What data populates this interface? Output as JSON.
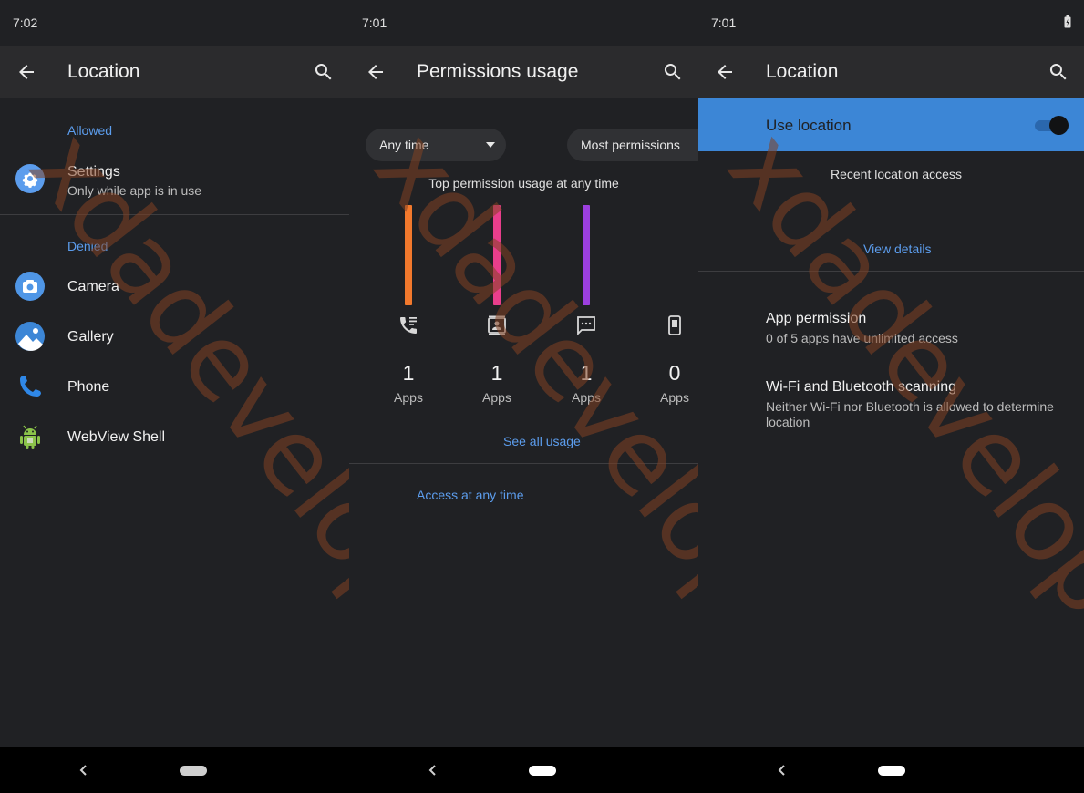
{
  "watermark": "xdadevelopers",
  "screens": [
    {
      "time": "7:02",
      "title": "Location",
      "allowed_label": "Allowed",
      "allowed": [
        {
          "name": "Settings",
          "detail": "Only while app is in use",
          "icon": "settings-gear-icon",
          "color": "#5c9ded"
        }
      ],
      "denied_label": "Denied",
      "denied": [
        {
          "name": "Camera",
          "icon": "camera-icon",
          "color": "#4f96e6"
        },
        {
          "name": "Gallery",
          "icon": "gallery-icon",
          "color": "#3c86d6"
        },
        {
          "name": "Phone",
          "icon": "phone-icon",
          "color": "#2f88e8"
        },
        {
          "name": "WebView Shell",
          "icon": "android-icon",
          "color": "#8bc34a"
        }
      ]
    },
    {
      "time": "7:01",
      "title": "Permissions usage",
      "filter_time": "Any time",
      "filter_sort": "Most permissions",
      "chart_title": "Top permission usage at any time",
      "chart_data": {
        "type": "bar",
        "categories": [
          "call-log-icon",
          "contacts-icon",
          "sms-icon",
          "phone-device-icon"
        ],
        "values": [
          1,
          1,
          1,
          0
        ],
        "colors": [
          "#f2792d",
          "#e83e8c",
          "#9c3fdf",
          "#5c9ded"
        ],
        "unit_label": "Apps"
      },
      "see_all": "See all usage",
      "access_any_time": "Access at any time"
    },
    {
      "time": "7:01",
      "title": "Location",
      "use_location": "Use location",
      "use_location_on": true,
      "recent_access": "Recent location access",
      "view_details": "View details",
      "items": [
        {
          "title": "App permission",
          "detail": "0 of 5 apps have unlimited access"
        },
        {
          "title": "Wi-Fi and Bluetooth scanning",
          "detail": "Neither Wi-Fi nor Bluetooth is allowed to determine location"
        }
      ]
    }
  ],
  "colors": {
    "background": "#202124",
    "appbar": "#2b2b2d",
    "accent": "#5c9ded",
    "highlight": "#3c86d6"
  }
}
